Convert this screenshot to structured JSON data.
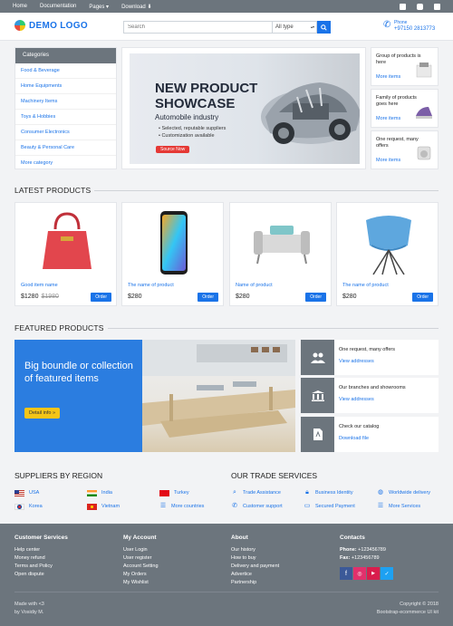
{
  "topbar": {
    "nav": [
      "Home",
      "Documentation",
      "Pages ▾",
      "Download"
    ],
    "social_icons": [
      "facebook-icon",
      "instagram-icon",
      "twitter-icon"
    ]
  },
  "header": {
    "logo_text": "DEMO LOGO",
    "search_placeholder": "Search",
    "search_scope": "All type",
    "phone_label": "Phone",
    "phone_number": "+97150 2813773"
  },
  "categories": {
    "title": "Categories",
    "items": [
      "Food & Beverage",
      "Home Equipments",
      "Machinery Items",
      "Toys & Hobbies",
      "Consumer Electronics",
      "Beauty & Personal Care",
      "More category"
    ]
  },
  "banner": {
    "title_line1": "NEW PRODUCT",
    "title_line2": "SHOWCASE",
    "subtitle": "Automobile industry",
    "bullet1": "• Selected, reputable suppliers",
    "bullet2": "• Customization available",
    "button": "Source Now"
  },
  "side_ads": [
    {
      "text": "Group of products is here",
      "link": "More items"
    },
    {
      "text": "Family of products goes here",
      "link": "More items"
    },
    {
      "text": "One request, many offers",
      "link": "More items"
    }
  ],
  "latest": {
    "title": "LATEST PRODUCTS",
    "products": [
      {
        "name": "Good item name",
        "price": "$1280",
        "old_price": "$1980",
        "order": "Order"
      },
      {
        "name": "The name of product",
        "price": "$280",
        "old_price": "",
        "order": "Order"
      },
      {
        "name": "Name of product",
        "price": "$280",
        "old_price": "",
        "order": "Order"
      },
      {
        "name": "The name of product",
        "price": "$280",
        "old_price": "",
        "order": "Order"
      }
    ]
  },
  "featured": {
    "title": "FEATURED PRODUCTS",
    "promo_text": "Big boundle or collection of featured items",
    "promo_button": "Detail info »",
    "items": [
      {
        "title": "One request, many offers",
        "link": "View addresses"
      },
      {
        "title": "Our branches and showrooms",
        "link": "View addresses"
      },
      {
        "title": "Check our catalog",
        "link": "Download file"
      }
    ]
  },
  "suppliers": {
    "title": "SUPPLIERS BY REGION",
    "items": [
      "USA",
      "India",
      "Turkey",
      "Korea",
      "Vietnam",
      "More countries"
    ]
  },
  "trade": {
    "title": "OUR TRADE SERVICES",
    "items": [
      "Trade Assistance",
      "Business Identity",
      "Worldwide delivery",
      "Customer support",
      "Secured Payment",
      "More Services"
    ]
  },
  "footer": {
    "customer_services": {
      "title": "Customer Services",
      "items": [
        "Help center",
        "Money refund",
        "Terms and Policy",
        "Open dispute"
      ]
    },
    "my_account": {
      "title": "My Account",
      "items": [
        "User Login",
        "User register",
        "Account Setting",
        "My Orders",
        "My Wishlist"
      ]
    },
    "about": {
      "title": "About",
      "items": [
        "Our history",
        "How to buy",
        "Delivery and payment",
        "Advertice",
        "Partnership"
      ]
    },
    "contacts": {
      "title": "Contacts",
      "phone_label": "Phone:",
      "phone": " +123456789",
      "fax_label": "Fax:",
      "fax": " +123456789"
    },
    "made_with": "Made with <3",
    "by": "by Vosidiy M.",
    "copyright": "Copyright © 2018",
    "kit": "Bootstrap-ecommerce UI kit"
  },
  "colors": {
    "accent": "#1a73e8",
    "gray": "#6c757d",
    "red": "#e53935",
    "yellow": "#f5c518"
  }
}
